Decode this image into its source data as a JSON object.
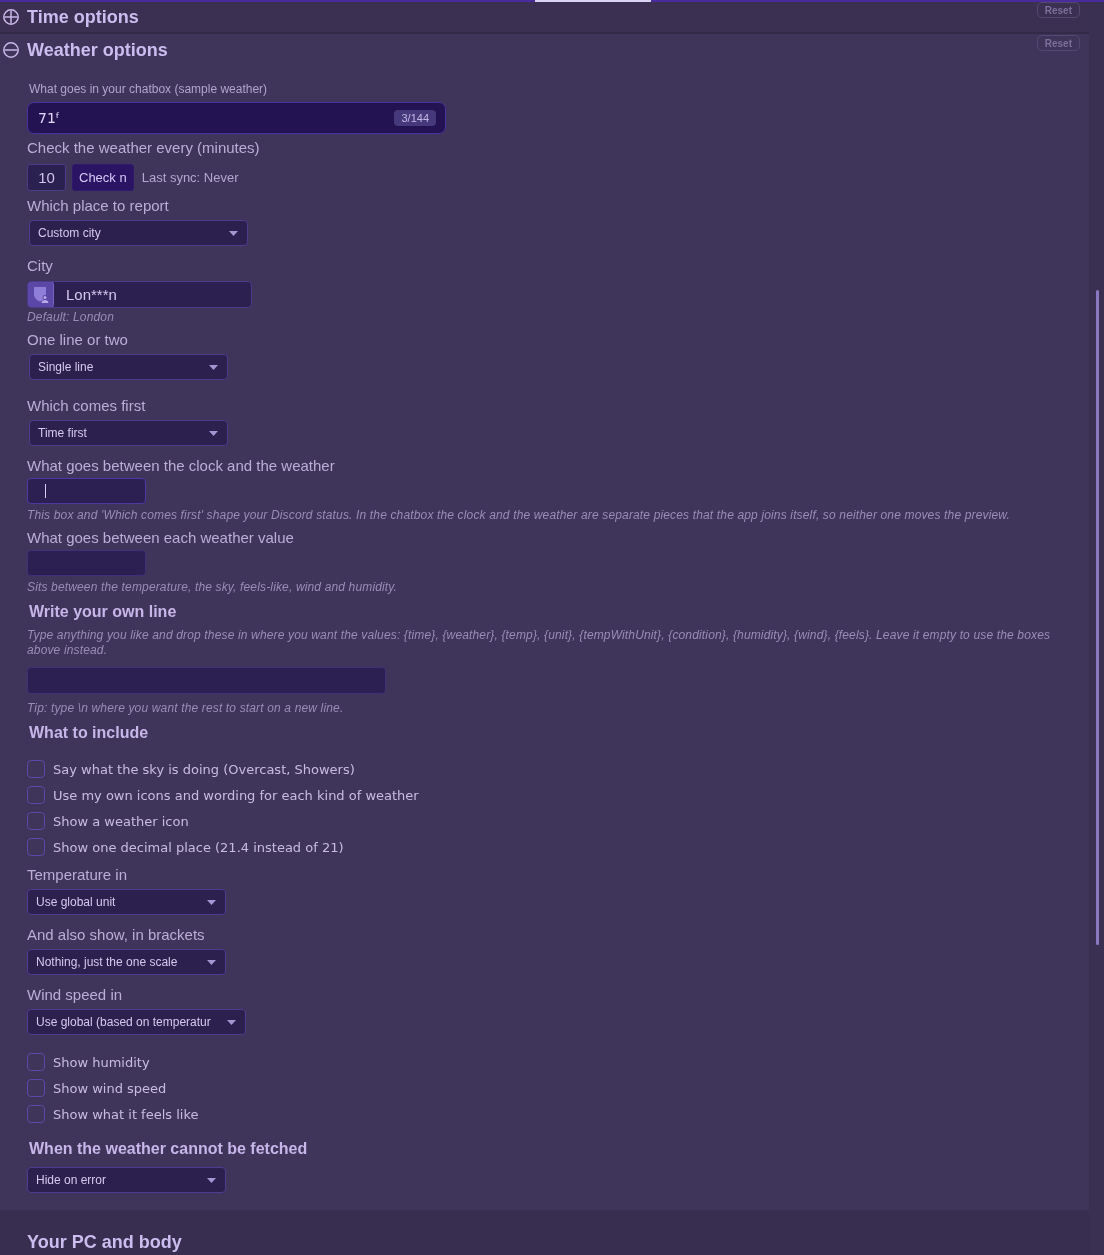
{
  "sections": [
    {
      "title": "Time options",
      "expanded": false,
      "reset": "Reset"
    },
    {
      "title": "Weather options",
      "expanded": true,
      "reset": "Reset",
      "items": [
        {
          "kind": "textbox",
          "label": "What goes in your chatbox (sample weather)",
          "value": "71ᶠ",
          "counter": "3/144"
        },
        {
          "kind": "interval",
          "label": "Check the weather every (minutes)",
          "value": "10",
          "button": "Check n",
          "status": "Last sync: Never"
        },
        {
          "kind": "select",
          "label": "Which place to report",
          "value": "Custom city"
        },
        {
          "kind": "city",
          "label": "City",
          "value": "Lon***n",
          "hint": "Default: London"
        },
        {
          "kind": "select",
          "label": "One line or two",
          "value": "Single line"
        },
        {
          "kind": "select",
          "label": "Which comes first",
          "value": "Time first"
        },
        {
          "kind": "input",
          "label": "What goes between the clock and the weather",
          "focused": true,
          "hint": "This box and 'Which comes first' shape your Discord status. In the chatbox the clock and the weather are separate pieces that the app joins itself, so neither one moves the preview."
        },
        {
          "kind": "input",
          "label": "What goes between each weather value",
          "focused": false,
          "hint": "Sits between the temperature, the sky, feels-like, wind and humidity."
        },
        {
          "kind": "template",
          "title": "Write your own line",
          "description": "Type anything you like and drop these in where you want the values: {time}, {weather}, {temp}, {unit}, {tempWithUnit}, {condition}, {humidity}, {wind}, {feels}. Leave it empty to use the boxes above instead.",
          "tip": "Tip: type \\n where you want the rest to start on a new line."
        },
        {
          "kind": "heading",
          "text": "What to include"
        },
        {
          "kind": "checkbox",
          "label": "Say what the sky is doing (Overcast, Showers)",
          "checked": false
        },
        {
          "kind": "checkbox",
          "label": "Use my own icons and wording for each kind of weather",
          "checked": false
        },
        {
          "kind": "checkbox",
          "label": "Show a weather icon",
          "checked": false
        },
        {
          "kind": "checkbox",
          "label": "Show one decimal place (21.4 instead of 21)",
          "checked": false
        },
        {
          "kind": "select",
          "label": "Temperature in",
          "value": "Use global unit"
        },
        {
          "kind": "select",
          "label": "And also show, in brackets",
          "value": "Nothing, just the one scale"
        },
        {
          "kind": "select",
          "label": "Wind speed in",
          "value": "Use global (based on temperatur"
        },
        {
          "kind": "checkbox",
          "label": "Show humidity",
          "checked": false
        },
        {
          "kind": "checkbox",
          "label": "Show wind speed",
          "checked": false
        },
        {
          "kind": "checkbox",
          "label": "Show what it feels like",
          "checked": false
        },
        {
          "kind": "heading",
          "text": "When the weather cannot be fetched"
        },
        {
          "kind": "select",
          "value": "Hide on error"
        }
      ]
    },
    {
      "title": "Your PC and body"
    }
  ]
}
